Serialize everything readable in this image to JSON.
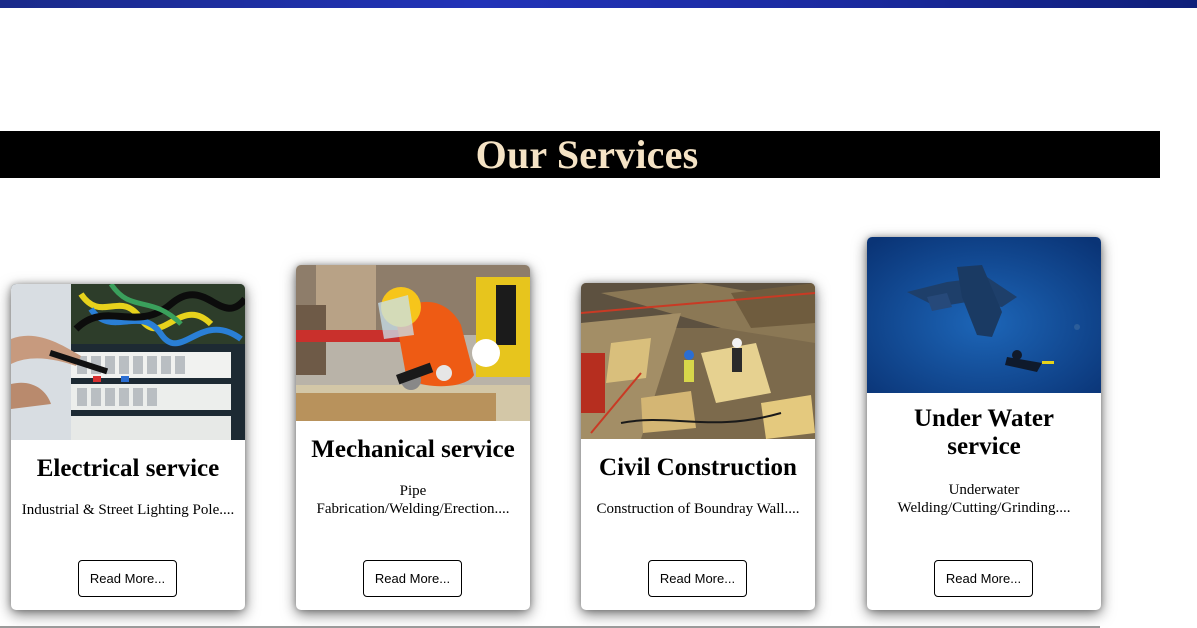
{
  "header": {
    "title": "Our Services"
  },
  "services": [
    {
      "title": "Electrical service",
      "description": "Industrial & Street Lighting Pole....",
      "button_label": "Read More...",
      "image_icon": "electrical-panel-photo"
    },
    {
      "title": "Mechanical service",
      "description": "Pipe Fabrication/Welding/Erection....",
      "button_label": "Read More...",
      "image_icon": "welder-grinding-photo"
    },
    {
      "title": "Civil Construction",
      "description": "Construction of Boundray Wall....",
      "button_label": "Read More...",
      "image_icon": "construction-site-photo"
    },
    {
      "title": "Under Water service",
      "description": "Underwater Welding/Cutting/Grinding....",
      "button_label": "Read More...",
      "image_icon": "underwater-diver-photo"
    }
  ],
  "colors": {
    "banner_background": "#000000",
    "banner_text": "#f5e3c5",
    "top_band": "#2233b8"
  }
}
